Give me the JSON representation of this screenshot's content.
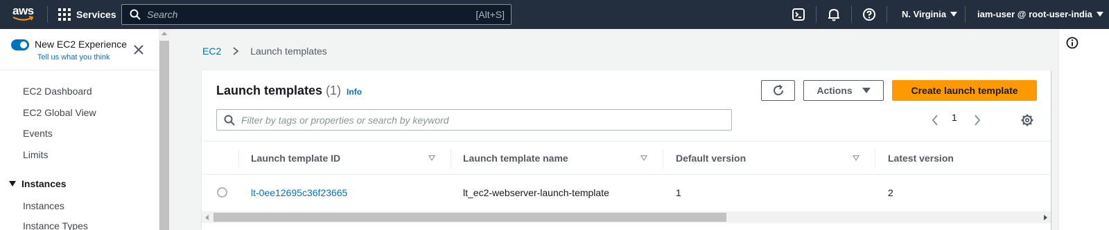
{
  "topnav": {
    "logo_text": "aws",
    "services_label": "Services",
    "search_placeholder": "Search",
    "search_shortcut": "[Alt+S]",
    "icons": [
      "cloudshell-icon",
      "bell-icon",
      "help-icon"
    ],
    "region": "N. Virginia",
    "user": "iam-user @ root-user-india"
  },
  "sidebar": {
    "toggle_label": "New EC2 Experience",
    "feedback_link": "Tell us what you think",
    "items": [
      "EC2 Dashboard",
      "EC2 Global View",
      "Events",
      "Limits"
    ],
    "section": "Instances",
    "section_items": [
      "Instances",
      "Instance Types"
    ]
  },
  "breadcrumb": {
    "root": "EC2",
    "current": "Launch templates"
  },
  "panel": {
    "title": "Launch templates",
    "count": "(1)",
    "info": "Info",
    "actions_label": "Actions",
    "create_label": "Create launch template",
    "filter_placeholder": "Filter by tags or properties or search by keyword",
    "page": "1",
    "columns": [
      "Launch template ID",
      "Launch template name",
      "Default version",
      "Latest version"
    ],
    "rows": [
      {
        "id": "lt-0ee12695c36f23665",
        "name": "lt_ec2-webserver-launch-template",
        "default_version": "1",
        "latest_version": "2"
      }
    ]
  },
  "colors": {
    "nav_bg": "#232f3e",
    "link": "#0073bb",
    "primary_button": "#ff9900",
    "page_bg": "#f2f3f3"
  }
}
